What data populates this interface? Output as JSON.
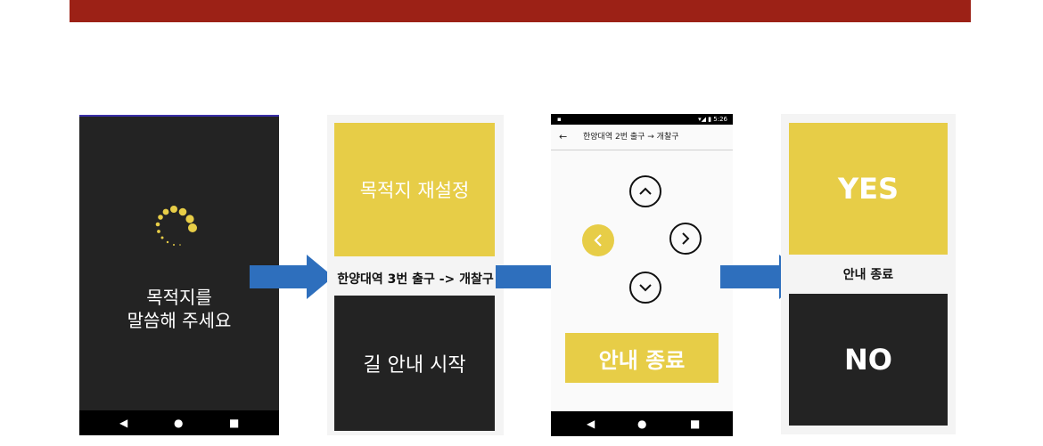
{
  "colors": {
    "banner": "#9c2116",
    "accent_yellow": "#e7cd47",
    "dark": "#232323",
    "arrow_blue": "#2e6fbd"
  },
  "screen1": {
    "prompt_line1": "목적지를",
    "prompt_line2": "말씀해 주세요",
    "spinner_icon": "loading-spinner-icon",
    "nav": {
      "back": "◀",
      "home": "●",
      "recent": "■"
    }
  },
  "screen2": {
    "reset_button": "목적지 재설정",
    "route": "한양대역 3번 출구 -> 개찰구",
    "start_button": "길 안내 시작"
  },
  "screen3": {
    "status_left": "▪",
    "status_right": "▾◢ ▮ 5:26",
    "back_icon": "←",
    "title": "한양대역 2번 출구 → 개찰구",
    "direction_icons": [
      "chevron-up-icon",
      "chevron-left-icon",
      "chevron-right-icon",
      "chevron-down-icon"
    ],
    "active_direction": "left",
    "end_button": "안내 종료",
    "nav": {
      "back": "◀",
      "home": "●",
      "recent": "■"
    }
  },
  "screen4": {
    "yes_button": "YES",
    "question": "안내 종료",
    "no_button": "NO"
  }
}
